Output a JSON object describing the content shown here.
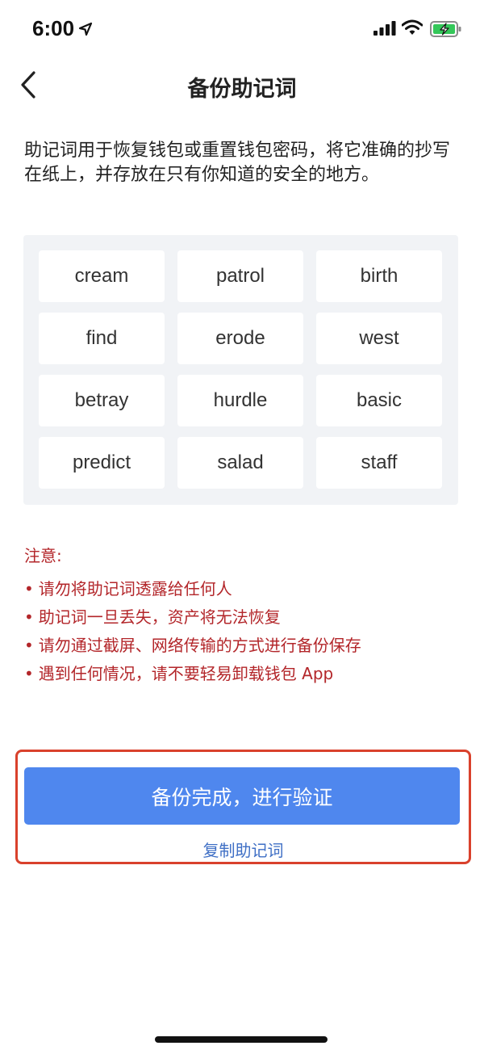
{
  "status_bar": {
    "time": "6:00",
    "icons": [
      "location-arrow-icon",
      "cellular-signal-icon",
      "wifi-icon",
      "battery-charging-icon"
    ],
    "battery_color": "#34c759"
  },
  "nav": {
    "back_icon": "chevron-left-icon",
    "title": "备份助记词"
  },
  "description": "助记词用于恢复钱包或重置钱包密码，将它准确的抄写在纸上，并存放在只有你知道的安全的地方。",
  "mnemonic": {
    "words": [
      "cream",
      "patrol",
      "birth",
      "find",
      "erode",
      "west",
      "betray",
      "hurdle",
      "basic",
      "predict",
      "salad",
      "staff"
    ]
  },
  "notice": {
    "title": "注意:",
    "items": [
      "请勿将助记词透露给任何人",
      "助记词一旦丢失，资产将无法恢复",
      "请勿通过截屏、网络传输的方式进行备份保存",
      "遇到任何情况，请不要轻易卸载钱包 App"
    ],
    "color": "#b3262a"
  },
  "actions": {
    "primary_label": "备份完成，进行验证",
    "copy_label": "复制助记词",
    "primary_color": "#4f87ee",
    "highlight_border_color": "#d9412c"
  }
}
